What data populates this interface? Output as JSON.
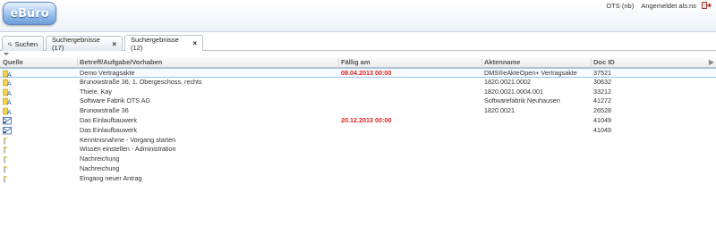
{
  "app": {
    "logo_text": "eBüro"
  },
  "user": {
    "system": "OTS (nb)",
    "logged_in": "Angemeldet als:ns"
  },
  "tabs": [
    {
      "label": "Suchen",
      "has_close": false
    },
    {
      "label": "Suchergebnisse (17)",
      "has_close": true,
      "close": "×"
    },
    {
      "label": "Suchergebnisse (12)",
      "has_close": true,
      "close": "×",
      "active": true
    }
  ],
  "grid": {
    "columns": [
      "Quelle",
      "Betreff/Aufgabe/Vorhaben",
      "Fällig am",
      "Aktenname",
      "Doc ID"
    ],
    "rows": [
      {
        "icon": "document-a-icon",
        "task": "Demo Vertragsakte",
        "due": "08.04.2013 00:00",
        "name": "DMS®eAkteOpen+ Vertragsakte",
        "id": "37521"
      },
      {
        "icon": "document-a-icon",
        "task": "Brunowstraße 36, 1. Obergeschoss, rechts",
        "due": "",
        "name": "1820.0021.0002",
        "id": "30632"
      },
      {
        "icon": "document-a-icon",
        "task": "Thiele, Kay",
        "due": "",
        "name": "1820.0021.0004.001",
        "id": "33212"
      },
      {
        "icon": "document-a-icon",
        "task": "Software Fabrik OTS AG",
        "due": "",
        "name": "Softwarefabrik Neuhausen",
        "id": "41272"
      },
      {
        "icon": "document-a-icon",
        "task": "Brunowstraße 36",
        "due": "",
        "name": "1820.0021",
        "id": "26528"
      },
      {
        "icon": "mail-inbox-icon",
        "task": "Das Einlaufbauwerk",
        "due": "20.12.2013 00:00",
        "name": "",
        "id": "41049"
      },
      {
        "icon": "mail-inbox-icon",
        "task": "Das Einlaufbauwerk",
        "due": "",
        "name": "",
        "id": "41049"
      },
      {
        "icon": "flag-icon",
        "task": "Kenntnisnahme - Vorgang starten",
        "due": "",
        "name": "",
        "id": ""
      },
      {
        "icon": "flag-icon",
        "task": "Wissen einstellen - Administration",
        "due": "",
        "name": "",
        "id": ""
      },
      {
        "icon": "flag-icon",
        "task": "Nachreichung",
        "due": "",
        "name": "",
        "id": ""
      },
      {
        "icon": "flag-icon",
        "task": "Nachreichung",
        "due": "",
        "name": "",
        "id": ""
      },
      {
        "icon": "flag-icon",
        "task": "Eingang neuer Antrag",
        "due": "",
        "name": "",
        "id": ""
      }
    ]
  },
  "colors": {
    "due_red": "#e02020",
    "accent_blue": "#6e9cd9"
  }
}
